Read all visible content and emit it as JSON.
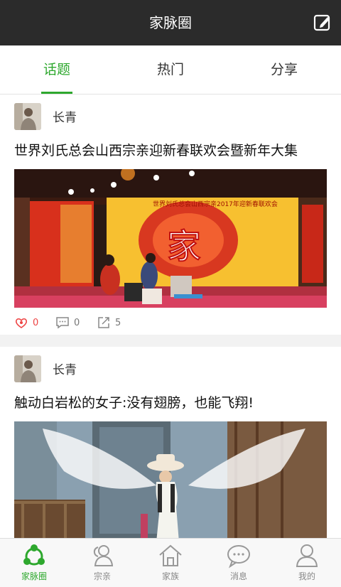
{
  "header": {
    "title": "家脉圈"
  },
  "tabs": [
    {
      "label": "话题",
      "active": true
    },
    {
      "label": "热门",
      "active": false
    },
    {
      "label": "分享",
      "active": false
    }
  ],
  "posts": [
    {
      "author": "长青",
      "title": "世界刘氏总会山西宗亲迎新春联欢会暨新年大集",
      "likes": "0",
      "comments": "0",
      "shares": "5",
      "banner_text": "世界刘氏总会山西宗亲2017年迎新春联欢会",
      "big_char": "家"
    },
    {
      "author": "长青",
      "title": "触动白岩松的女子:没有翅膀，也能飞翔!"
    }
  ],
  "bottom_nav": [
    {
      "label": "家脉圈",
      "icon": "circle-network-icon",
      "active": true
    },
    {
      "label": "宗亲",
      "icon": "users-icon",
      "active": false
    },
    {
      "label": "家族",
      "icon": "home-icon",
      "active": false
    },
    {
      "label": "消息",
      "icon": "chat-icon",
      "active": false
    },
    {
      "label": "我的",
      "icon": "user-icon",
      "active": false
    }
  ],
  "colors": {
    "accent": "#2ea82e",
    "header_bg": "#2b2b2b",
    "like": "#e44444"
  }
}
